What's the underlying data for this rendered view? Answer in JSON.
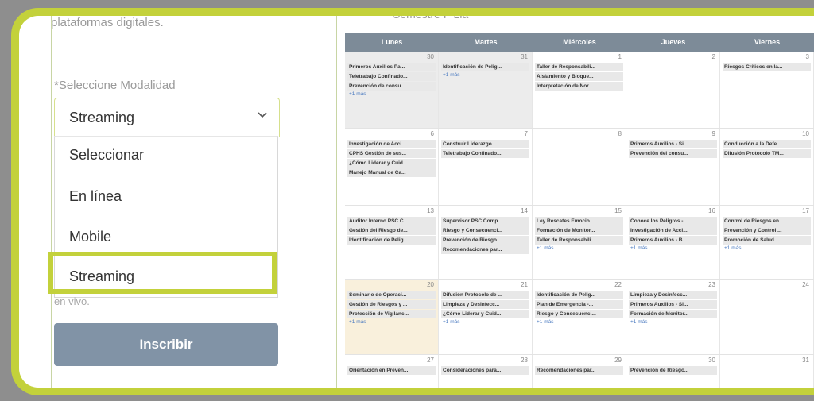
{
  "form": {
    "description": "plataformas digitales.",
    "modality_label": "*Seleccione Modalidad",
    "selected": "Streaming",
    "options": [
      "Seleccionar",
      "En línea",
      "Mobile",
      "Streaming"
    ],
    "hint": "en vivo.",
    "submit_label": "Inscribir"
  },
  "calendar": {
    "title": "Semestre I \"Lia\"",
    "days": [
      "Lunes",
      "Martes",
      "Miércoles",
      "Jueves",
      "Viernes"
    ],
    "more_label": "+1 más",
    "weeks": [
      {
        "h": 96,
        "cells": [
          {
            "num": "30",
            "grey": true,
            "events": [
              "Primeros Auxilios Pa...",
              "Teletrabajo Confinado...",
              "Prevención de consu..."
            ],
            "more": true
          },
          {
            "num": "31",
            "grey": true,
            "events": [
              "Identificación de Pelig..."
            ],
            "more": true
          },
          {
            "num": "1",
            "events": [
              "Taller de Responsabili...",
              "Aislamiento y Bloque...",
              "Interpretación de Nor..."
            ],
            "more": false
          },
          {
            "num": "2",
            "events": [],
            "more": false
          },
          {
            "num": "3",
            "events": [
              "Riesgos Críticos en la..."
            ],
            "more": false
          }
        ]
      },
      {
        "h": 96,
        "cells": [
          {
            "num": "6",
            "events": [
              "Investigación de Acci...",
              "CPHS Gestión de sus...",
              "¿Cómo Liderar y Cuid...",
              "Manejo Manual de Ca..."
            ],
            "more": false
          },
          {
            "num": "7",
            "events": [
              "Construir Liderazgo...",
              "Teletrabajo Confinado..."
            ],
            "more": false
          },
          {
            "num": "8",
            "events": [],
            "more": false
          },
          {
            "num": "9",
            "events": [
              "Primeros Auxilios - Si...",
              "Prevención del consu..."
            ],
            "more": false
          },
          {
            "num": "10",
            "events": [
              "Conducción a la Defe...",
              "Difusión Protocolo TM..."
            ],
            "more": false
          }
        ]
      },
      {
        "h": 92,
        "cells": [
          {
            "num": "13",
            "events": [
              "Auditor Interno PSC C...",
              "Gestión del Riesgo de...",
              "Identificación de Pelig..."
            ],
            "more": false
          },
          {
            "num": "14",
            "events": [
              "Supervisor PSC Comp...",
              "Riesgo y Consecuenci...",
              "Prevención de Riesgo...",
              "Recomendaciones par..."
            ],
            "more": false
          },
          {
            "num": "15",
            "events": [
              "Ley Rescates Emocio...",
              "Formación de Monitor...",
              "Taller de Responsabili..."
            ],
            "more": true
          },
          {
            "num": "16",
            "events": [
              "Conoce los Peligros -...",
              "Investigación de Acci...",
              "Primeros Auxilios - B..."
            ],
            "more": true
          },
          {
            "num": "17",
            "events": [
              "Control de Riesgos en...",
              "Prevención y Control ...",
              "Promoción de Salud ..."
            ],
            "more": true
          }
        ]
      },
      {
        "h": 94,
        "cells": [
          {
            "num": "20",
            "today": true,
            "events": [
              "Seminario de Operaci...",
              "Gestión de Riesgos y ...",
              "Protección de Vigilanc..."
            ],
            "more": true
          },
          {
            "num": "21",
            "events": [
              "Difusión Protocolo de ...",
              "Limpieza y Desinfecc...",
              "¿Cómo Liderar y Cuid..."
            ],
            "more": true
          },
          {
            "num": "22",
            "events": [
              "Identificación de Pelig...",
              "Plan de Emergencia -...",
              "Riesgo y Consecuenci..."
            ],
            "more": true
          },
          {
            "num": "23",
            "events": [
              "Limpieza y Desinfecc...",
              "Primeros Auxilios - Si...",
              "Formación de Monitor..."
            ],
            "more": true
          },
          {
            "num": "24",
            "events": [],
            "more": false
          }
        ]
      },
      {
        "h": 48,
        "cells": [
          {
            "num": "27",
            "events": [
              "Orientación en Preven..."
            ],
            "more": false
          },
          {
            "num": "28",
            "events": [
              "Consideraciones para..."
            ],
            "more": false
          },
          {
            "num": "29",
            "events": [
              "Recomendaciones par..."
            ],
            "more": false
          },
          {
            "num": "30",
            "events": [
              "Prevención de Riesgo..."
            ],
            "more": false
          },
          {
            "num": "31",
            "events": [],
            "more": false
          }
        ]
      }
    ]
  },
  "colors": {
    "accent_border": "#c3d13b",
    "button": "#8193a6",
    "calendar_header": "#7d8b98"
  }
}
